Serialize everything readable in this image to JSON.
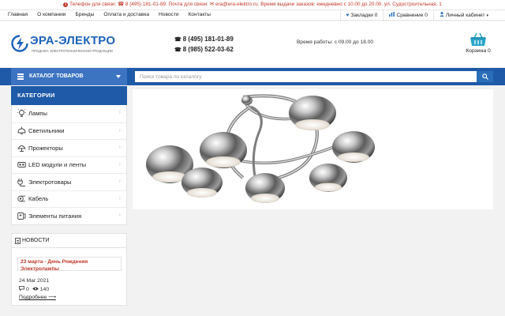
{
  "topbar": {
    "text": "Телефон для связи: ☎ 8 (495) 181-01-89. Почта для связи: ✉ era@era-elektro.ru. Время выдачи заказов: ежедневно с 10.00 до 20.00. ул. Судостроительная, 1"
  },
  "nav": {
    "links": [
      "Главная",
      "О компании",
      "Бренды",
      "Оплата и доставка",
      "Новости",
      "Контакты"
    ],
    "bookmarks": "Закладки 0",
    "compare": "Сравнение 0",
    "account": "Личный кабинет"
  },
  "header": {
    "logo_title": "ЭРА-ЭЛЕКТРО",
    "logo_subtitle": "продажа электротехнической продукции",
    "phone1": "8 (495) 181-01-89",
    "phone2": "8 (985) 522-03-62",
    "worktime": "Время работы: с 09.00 до 18.00",
    "cart_label": "Корзина 0"
  },
  "bluebar": {
    "catalog_label": "КАТАЛОГ ТОВАРОВ",
    "search_placeholder": "Поиск товара по каталогу"
  },
  "sidebar": {
    "header": "КАТЕГОРИИ",
    "items": [
      {
        "label": "Лампы",
        "icon": "bulb-icon"
      },
      {
        "label": "Светильники",
        "icon": "ceiling-lamp-icon"
      },
      {
        "label": "Прожекторы",
        "icon": "floodlight-icon"
      },
      {
        "label": "LED модули и ленты",
        "icon": "led-strip-icon"
      },
      {
        "label": "Электротовары",
        "icon": "plug-icon"
      },
      {
        "label": "Кабель",
        "icon": "cable-icon"
      },
      {
        "label": "Элементы питания",
        "icon": "battery-icon"
      }
    ]
  },
  "news": {
    "header": "НОВОСТИ",
    "title": "23 марта - День Рождения Электролампы",
    "date": "24 Mar 2021",
    "comments": "0",
    "views": "140",
    "more": "Подробнее"
  },
  "colors": {
    "brand_blue": "#1e5aa8",
    "accent_red": "#c0392b",
    "chrome": "#9a9a9a"
  }
}
